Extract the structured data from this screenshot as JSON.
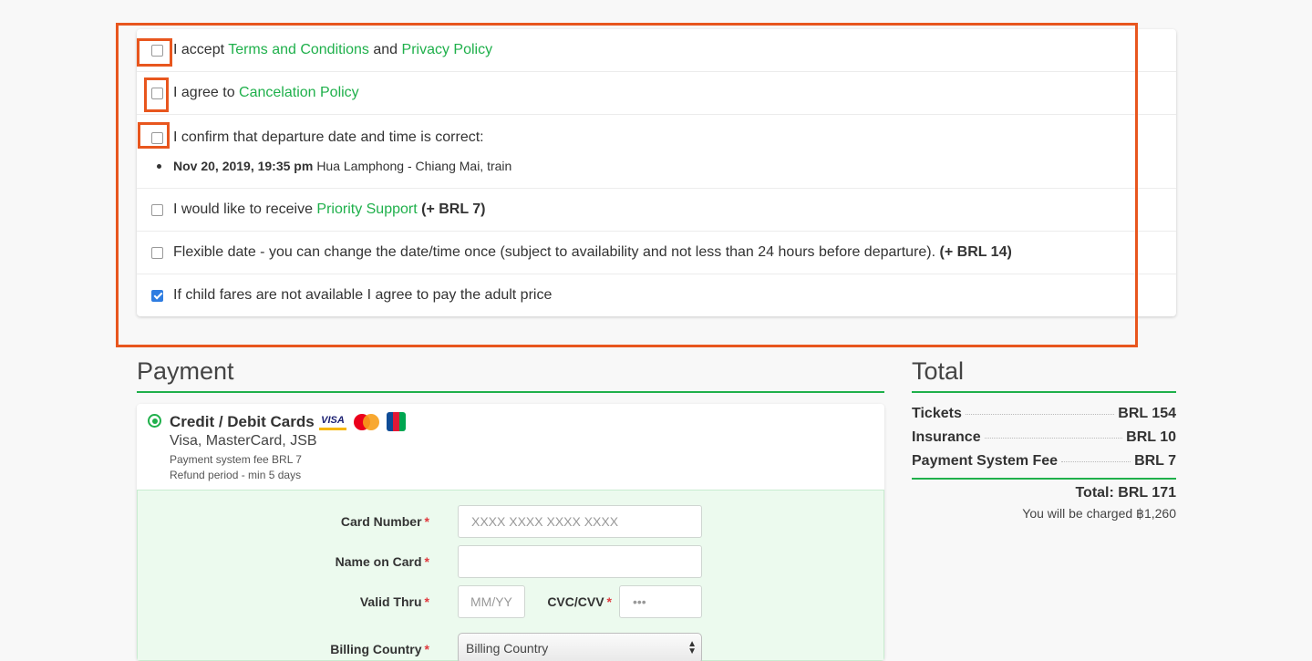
{
  "agreements": [
    {
      "prefix": "I accept ",
      "link1": "Terms and Conditions",
      "mid": " and ",
      "link2": "Privacy Policy",
      "checked": false
    },
    {
      "prefix": "I agree to ",
      "link1": "Cancelation Policy",
      "checked": false
    },
    {
      "prefix": "I confirm that departure date and time is correct:",
      "checked": false,
      "trip": {
        "datetime": "Nov 20, 2019, 19:35 pm",
        "route": "Hua Lamphong - Chiang Mai, train"
      }
    },
    {
      "prefix": "I would like to receive ",
      "link1": "Priority Support",
      "price": "(+ BRL 7)",
      "checked": false
    },
    {
      "prefix": "Flexible date - you can change the date/time once (subject to availability and not less than 24 hours before departure). ",
      "price": "(+ BRL 14)",
      "checked": false
    },
    {
      "prefix": "If child fares are not available I agree to pay the adult price",
      "checked": true
    }
  ],
  "payment": {
    "title": "Payment",
    "method": {
      "name": "Credit / Debit Cards",
      "networks": "Visa, MasterCard, JSB",
      "fee": "Payment system fee BRL 7",
      "refund": "Refund period - min 5 days",
      "logos": [
        "visa-logo",
        "mastercard-logo",
        "jcb-logo"
      ],
      "visa_text": "VISA"
    },
    "form": {
      "card_number_label": "Card Number",
      "card_number_placeholder": "XXXX XXXX XXXX XXXX",
      "name_label": "Name on Card",
      "name_value": "",
      "valid_label": "Valid Thru",
      "valid_placeholder": "MM/YY",
      "cvc_label": "CVC/CVV",
      "cvc_placeholder": "•••",
      "country_label": "Billing Country",
      "country_value": "Billing Country",
      "required_mark": "*"
    }
  },
  "total": {
    "title": "Total",
    "lines": [
      {
        "label": "Tickets",
        "value": "BRL 154"
      },
      {
        "label": "Insurance",
        "value": "BRL 10"
      },
      {
        "label": "Payment System Fee",
        "value": "BRL 7"
      }
    ],
    "total_label": "Total: BRL 171",
    "charged_text": "You will be charged ฿1,260"
  },
  "colors": {
    "accent": "#1fb04b",
    "highlight": "#e8561e",
    "checkbox_checked": "#2f7de1",
    "required": "#e0393e"
  }
}
